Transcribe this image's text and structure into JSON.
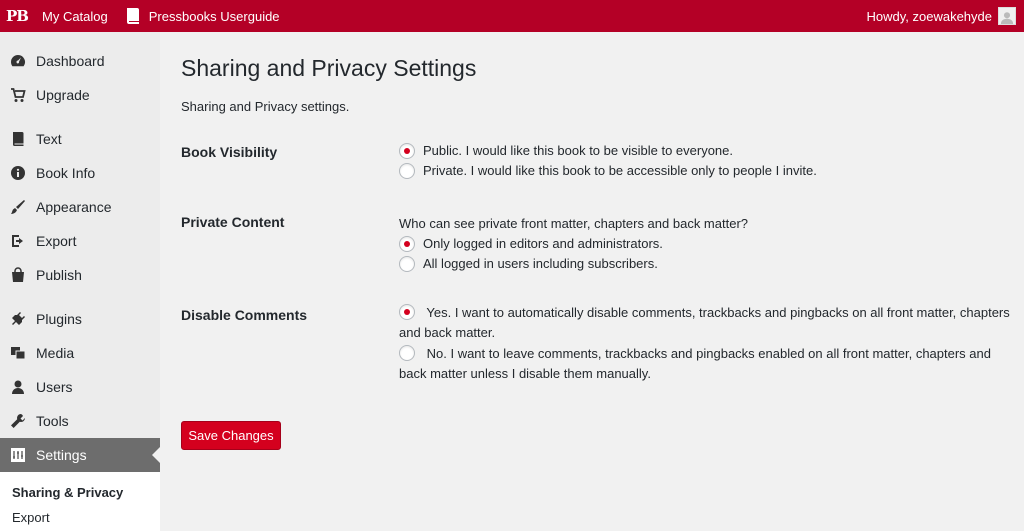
{
  "adminbar": {
    "logo": "PB",
    "my_catalog": "My Catalog",
    "book_title": "Pressbooks Userguide",
    "greeting": "Howdy, zoewakehyde"
  },
  "sidebar": {
    "items": [
      {
        "label": "Dashboard",
        "icon": "dashboard-icon"
      },
      {
        "label": "Upgrade",
        "icon": "cart-icon"
      },
      {
        "label": "Text",
        "icon": "book-icon"
      },
      {
        "label": "Book Info",
        "icon": "info-icon"
      },
      {
        "label": "Appearance",
        "icon": "brush-icon"
      },
      {
        "label": "Export",
        "icon": "export-icon"
      },
      {
        "label": "Publish",
        "icon": "shop-icon"
      },
      {
        "label": "Plugins",
        "icon": "plugin-icon"
      },
      {
        "label": "Media",
        "icon": "media-icon"
      },
      {
        "label": "Users",
        "icon": "user-icon"
      },
      {
        "label": "Tools",
        "icon": "wrench-icon"
      },
      {
        "label": "Settings",
        "icon": "settings-icon"
      }
    ],
    "submenu": [
      "Sharing & Privacy",
      "Export"
    ]
  },
  "main": {
    "title": "Sharing and Privacy Settings",
    "description": "Sharing and Privacy settings.",
    "book_visibility": {
      "label": "Book Visibility",
      "options": [
        "Public. I would like this book to be visible to everyone.",
        "Private. I would like this book to be accessible only to people I invite."
      ],
      "selected": 0
    },
    "private_content": {
      "label": "Private Content",
      "question": "Who can see private front matter, chapters and back matter?",
      "options": [
        "Only logged in editors and administrators.",
        "All logged in users including subscribers."
      ],
      "selected": 0
    },
    "disable_comments": {
      "label": "Disable Comments",
      "options": [
        "Yes. I want to automatically disable comments, trackbacks and pingbacks on all front matter, chapters and back matter.",
        "No. I want to leave comments, trackbacks and pingbacks enabled on all front matter, chapters and back matter unless I disable them manually."
      ],
      "selected": 0
    },
    "save_label": "Save Changes"
  },
  "colors": {
    "brand": "#b40026",
    "button": "#d4001e",
    "sidebar_bg": "#ececec",
    "active_menu": "#6d6d6d"
  }
}
